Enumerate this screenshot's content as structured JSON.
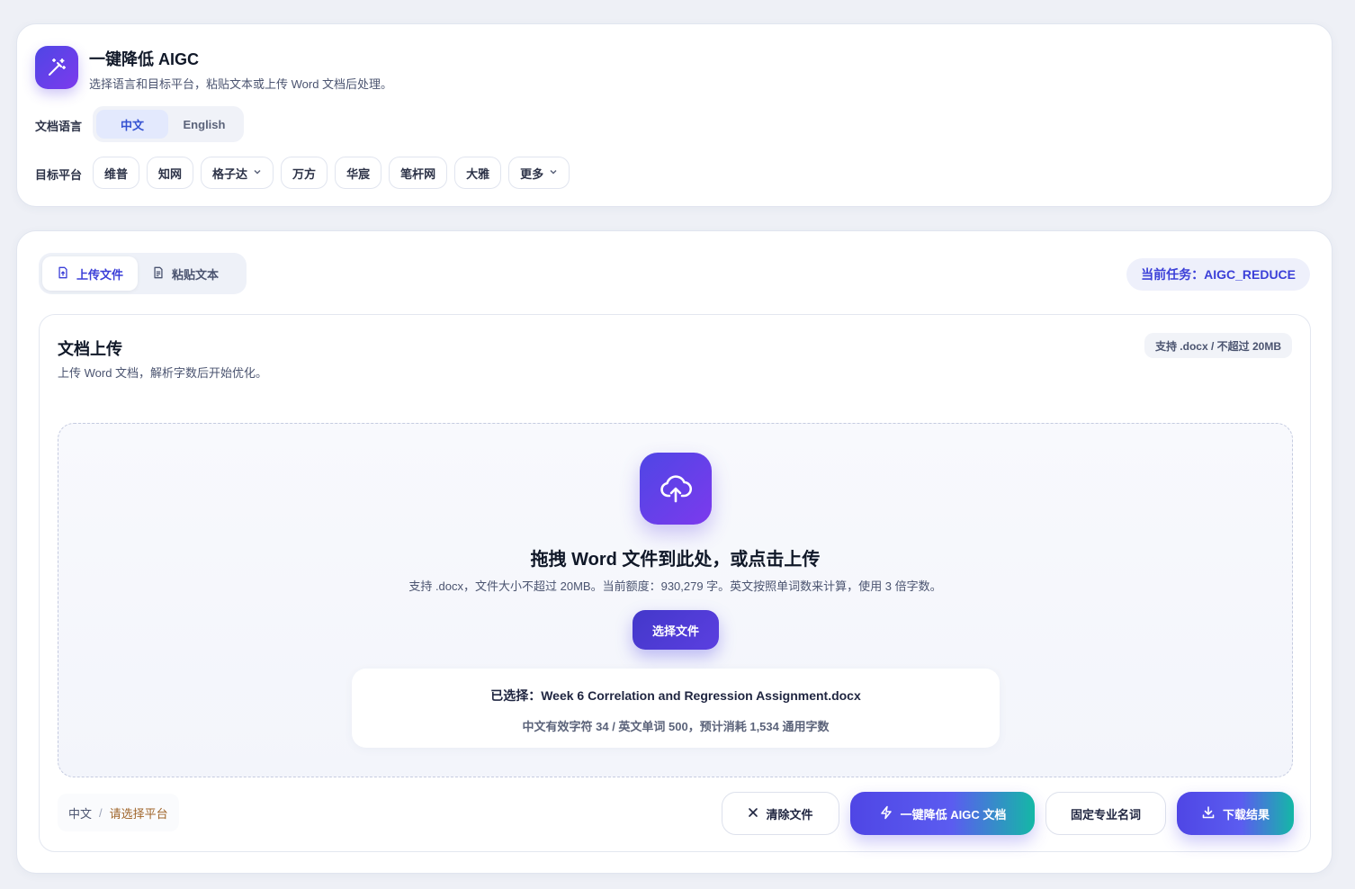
{
  "header": {
    "title": "一键降低 AIGC",
    "subtitle": "选择语言和目标平台，粘贴文本或上传 Word 文档后处理。"
  },
  "language": {
    "label": "文档语言",
    "options": [
      "中文",
      "English"
    ],
    "selected": "中文"
  },
  "platform": {
    "label": "目标平台",
    "options": [
      "维普",
      "知网",
      "格子达",
      "万方",
      "华宸",
      "笔杆网",
      "大雅",
      "更多"
    ]
  },
  "modes": {
    "upload": "上传文件",
    "paste": "粘贴文本",
    "selected": "上传文件"
  },
  "task_badge": "当前任务：AIGC_REDUCE",
  "upload": {
    "title": "文档上传",
    "subtitle": "上传 Word 文档，解析字数后开始优化。",
    "support_chip": "支持 .docx / 不超过 20MB",
    "dropzone_title": "拖拽 Word 文件到此处，或点击上传",
    "dropzone_desc": "支持 .docx，文件大小不超过 20MB。当前额度：930,279 字。英文按照单词数来计算，使用 3 倍字数。",
    "choose_label": "选择文件",
    "selected_file": "已选择：Week 6 Correlation and Regression Assignment.docx",
    "file_stats": "中文有效字符 34 / 英文单词 500，预计消耗 1,534 通用字数"
  },
  "footer": {
    "lang": "中文",
    "separator": "/",
    "platform_hint": "请选择平台",
    "clear": "清除文件",
    "reduce": "一键降低 AIGC 文档",
    "fix_terms": "固定专业名词",
    "download": "下载结果"
  },
  "colors": {
    "accent": "#4f46e5",
    "accent_purple": "#7c3aed",
    "teal": "#14b8a6",
    "hint": "#a0652a"
  }
}
